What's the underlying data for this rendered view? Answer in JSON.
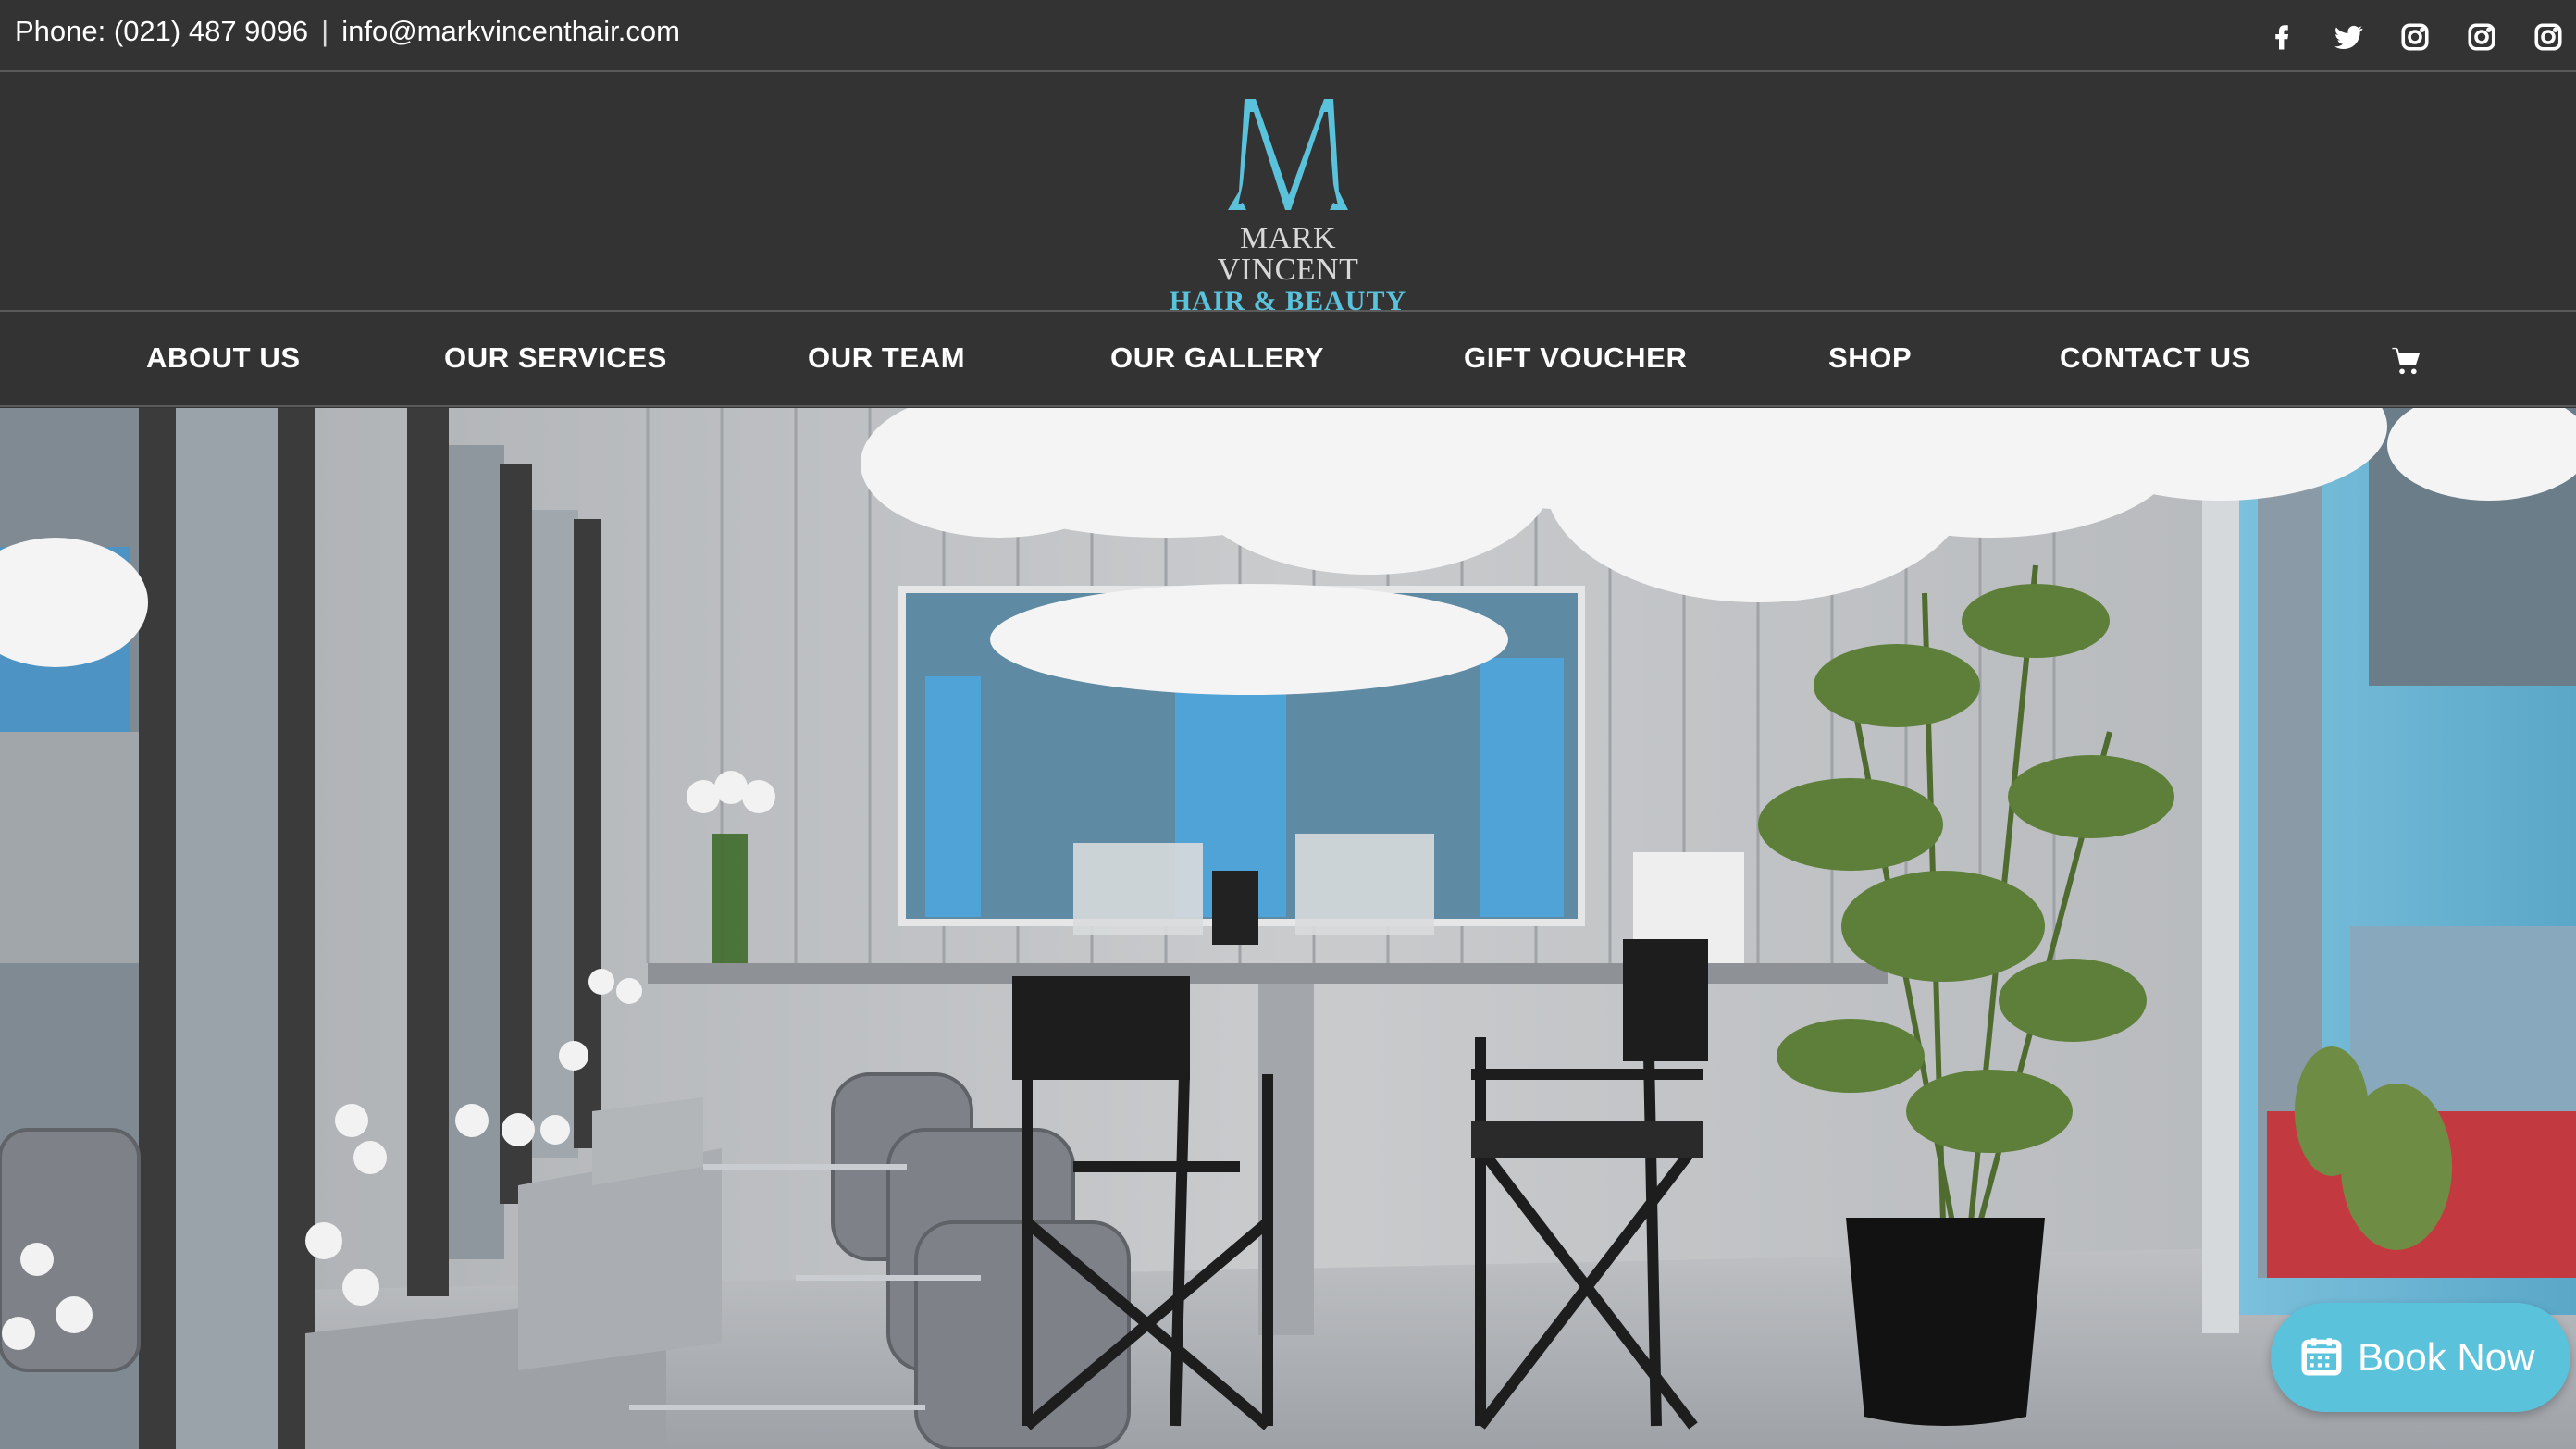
{
  "topbar": {
    "phone": "Phone: (021) 487 9096",
    "separator": "|",
    "email": "info@markvincenthair.com",
    "social_icons": [
      "facebook-icon",
      "twitter-icon",
      "instagram-icon",
      "instagram-icon",
      "instagram-icon"
    ]
  },
  "logo": {
    "monogram": "M",
    "line1": "MARK VINCENT",
    "line2": "HAIR & BEAUTY"
  },
  "nav": {
    "items": [
      {
        "label": "ABOUT US"
      },
      {
        "label": "OUR SERVICES"
      },
      {
        "label": "OUR TEAM"
      },
      {
        "label": "OUR GALLERY"
      },
      {
        "label": "GIFT VOUCHER"
      },
      {
        "label": "SHOP"
      },
      {
        "label": "CONTACT US"
      }
    ],
    "cart_icon": "shopping-cart-icon"
  },
  "hero": {
    "image_alt": "salon-interior-photo"
  },
  "book_now": {
    "label": "Book Now",
    "icon": "calendar-icon"
  },
  "colors": {
    "background": "#333333",
    "accent": "#5bc2dc",
    "text": "#ffffff",
    "divider": "#5a5a5a"
  }
}
